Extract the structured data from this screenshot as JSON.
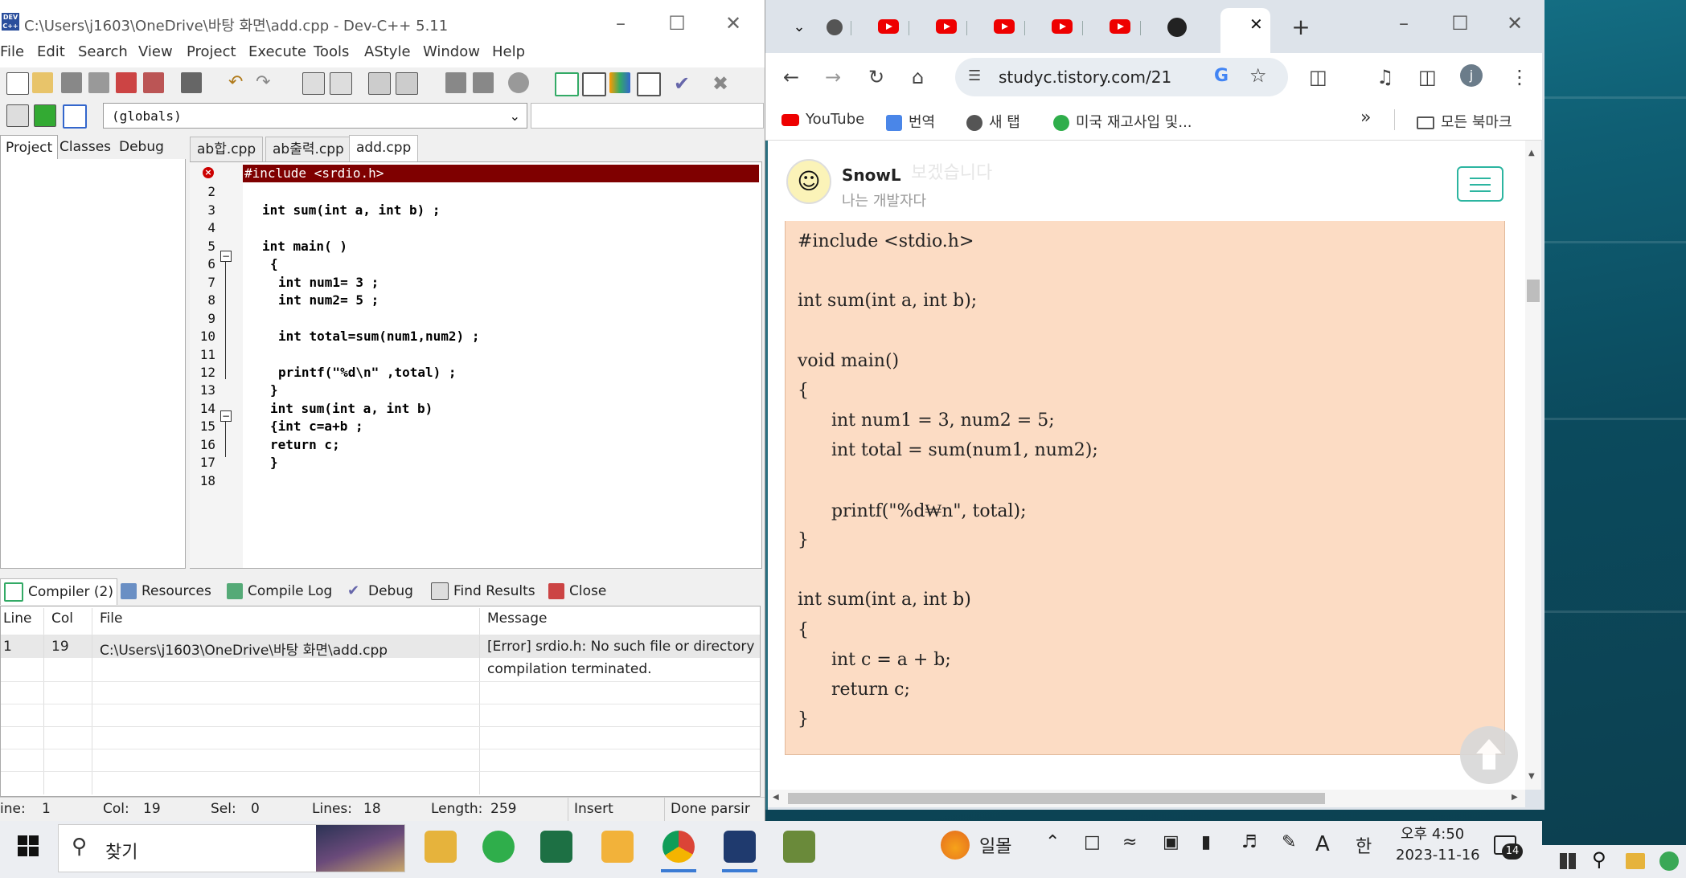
{
  "devcpp": {
    "title": "C:\\Users\\j1603\\OneDrive\\바탕 화면\\add.cpp - Dev-C++ 5.11",
    "app_icon_text": "DEV C++",
    "menu": [
      "File",
      "Edit",
      "Search",
      "View",
      "Project",
      "Execute",
      "Tools",
      "AStyle",
      "Window",
      "Help"
    ],
    "scope_select": "(globals)",
    "project_tabs": [
      "Project",
      "Classes",
      "Debug"
    ],
    "editor_tabs": [
      "ab합.cpp",
      "ab출력.cpp",
      "add.cpp"
    ],
    "active_editor_tab": "add.cpp",
    "line_numbers": [
      "1",
      "2",
      "3",
      "4",
      "5",
      "6",
      "7",
      "8",
      "9",
      "10",
      "11",
      "12",
      "13",
      "14",
      "15",
      "16",
      "17",
      "18"
    ],
    "code_lines": [
      "#include <srdio.h>",
      "",
      "int sum(int a, int b) ;",
      "",
      "int main( )",
      "{",
      "int num1= 3 ;",
      "int num2= 5 ;",
      "",
      "int total=sum(num1,num2) ;",
      "",
      "printf(\"%d\\n\" ,total) ;",
      "}",
      "int sum(int a, int b)",
      "{int c=a+b ;",
      "return c;",
      "}",
      ""
    ],
    "bottom_tabs": [
      "Compiler (2)",
      "Resources",
      "Compile Log",
      "Debug",
      "Find Results",
      "Close"
    ],
    "compiler_columns": [
      "Line",
      "Col",
      "File",
      "Message"
    ],
    "compiler_rows": [
      {
        "line": "1",
        "col": "19",
        "file": "C:\\Users\\j1603\\OneDrive\\바탕 화면\\add.cpp",
        "message": "[Error] srdio.h: No such file or directory"
      },
      {
        "line": "",
        "col": "",
        "file": "",
        "message": "compilation terminated."
      }
    ],
    "status": {
      "line_label": "ine:",
      "line": "1",
      "col_label": "Col:",
      "col": "19",
      "sel_label": "Sel:",
      "sel": "0",
      "lines_label": "Lines:",
      "lines": "18",
      "length_label": "Length:",
      "length": "259",
      "mode": "Insert",
      "parse": "Done parsir"
    }
  },
  "chrome": {
    "url": "studyc.tistory.com/21",
    "bookmarks": [
      "YouTube",
      "번역",
      "새 탭",
      "미국 재고사입 및...",
      "모든 북마크"
    ],
    "profile_initial": "j",
    "site": {
      "name": "SnowL",
      "subtitle": "나는 개발자다",
      "faded_header": "보겠습니다"
    },
    "code_lines": [
      "#include <stdio.h>",
      "",
      "int sum(int a, int b);",
      "",
      "void main()",
      "{",
      "      int num1 = 3, num2 = 5;",
      "      int total = sum(num1, num2);",
      "",
      "      printf(\"%d₩n\", total);",
      "}",
      "",
      "int sum(int a, int b)",
      "{",
      "      int c = a + b;",
      "      return c;",
      "}"
    ]
  },
  "taskbar": {
    "search_placeholder": "찾기",
    "weather": "일몰",
    "ime_a": "A",
    "ime_han": "한",
    "time": "오후 4:50",
    "date": "2023-11-16",
    "notifications": "14"
  },
  "colors": {
    "error_line": "#7f0000",
    "code_box": "#fcdcc4",
    "menu_accent": "#2cb5a0"
  }
}
